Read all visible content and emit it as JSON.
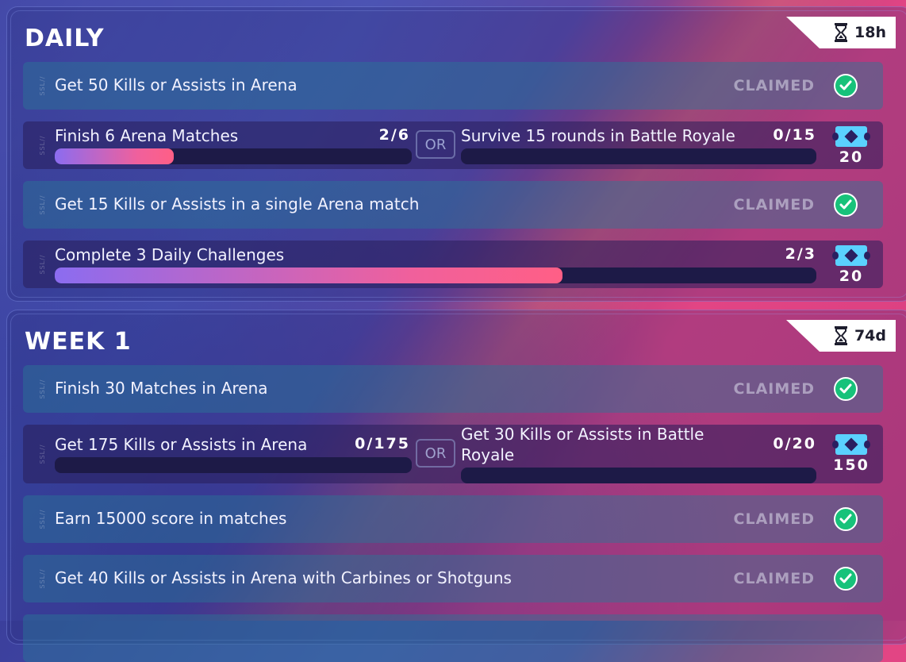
{
  "sidetag": "SSL//",
  "daily": {
    "title": "DAILY",
    "timer": "18h",
    "rows": [
      {
        "text": "Get 50 Kills or Assists in Arena",
        "status": "CLAIMED"
      },
      {
        "left_text": "Finish 6 Arena Matches",
        "left_count": "2/6",
        "left_progress": 0.333,
        "or": "OR",
        "right_text": "Survive 15 rounds in Battle Royale",
        "right_count": "0/15",
        "right_progress": 0.0,
        "reward": "20"
      },
      {
        "text": "Get 15 Kills or Assists in a single Arena match",
        "status": "CLAIMED"
      },
      {
        "text": "Complete 3 Daily Challenges",
        "count": "2/3",
        "progress": 0.667,
        "reward": "20"
      }
    ]
  },
  "week1": {
    "title": "WEEK 1",
    "timer": "74d",
    "rows": [
      {
        "text": "Finish 30 Matches in Arena",
        "status": "CLAIMED"
      },
      {
        "left_text": "Get 175 Kills or Assists in Arena",
        "left_count": "0/175",
        "left_progress": 0.0,
        "or": "OR",
        "right_text_line1": "Get 30 Kills or Assists in Battle",
        "right_text_line2": "Royale",
        "right_count": "0/20",
        "right_progress": 0.0,
        "reward": "150"
      },
      {
        "text": "Earn 15000 score in matches",
        "status": "CLAIMED"
      },
      {
        "text": "Get 40 Kills or Assists in Arena with Carbines or Shotguns",
        "status": "CLAIMED"
      }
    ]
  },
  "colors": {
    "claimed_check": "#17c27a",
    "progress_fill_start": "#8b6cf0",
    "progress_fill_end": "#ff5f86",
    "reward_ticket": "#5ad1ff"
  },
  "icons": [
    "hourglass-icon",
    "check-icon",
    "ticket-icon"
  ]
}
